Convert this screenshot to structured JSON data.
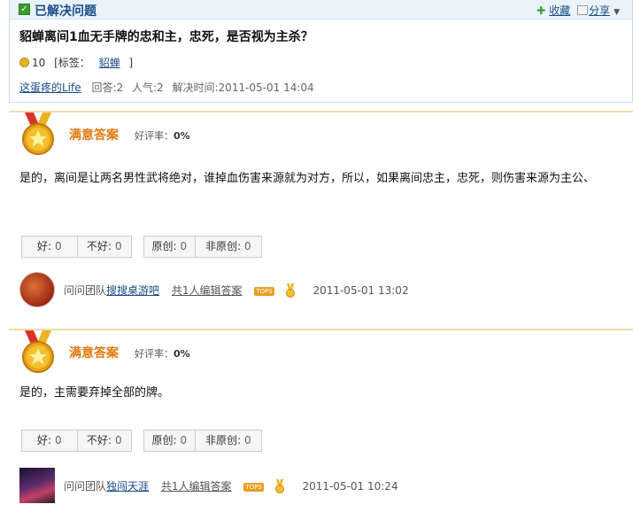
{
  "question": {
    "status_label": "已解决问题",
    "collect_label": "收藏",
    "share_label": "分享",
    "title": "貂蝉离间1血无手牌的忠和主，忠死，是否视为主杀？",
    "reward": "10",
    "tags_prefix": "[标签：",
    "tag": "貂蝉",
    "tags_suffix": "]",
    "asker": "这蛋疼的Life",
    "answers_count": "回答:2",
    "popularity": "人气:2",
    "solved_time": "解决时间:2011-05-01 14:04"
  },
  "answers": [
    {
      "title": "满意答案",
      "rate_label": "好评率：",
      "rate_value": "0%",
      "text": "是的，离间是让两名男性武将绝对，谁掉血伤害来源就为对方，所以，如果离间忠主，忠死，则伤害来源为主公、",
      "good_label": "好:",
      "good_count": "0",
      "bad_label": "不好:",
      "bad_count": "0",
      "orig_label": "原创:",
      "orig_count": "0",
      "nonorig_label": "非原创:",
      "nonorig_count": "0",
      "team_label": "问问团队",
      "user": "搜搜桌游吧",
      "editors": "共1人编辑答案",
      "tops_badge": "TOPS",
      "time": "2011-05-01 13:02"
    },
    {
      "title": "满意答案",
      "rate_label": "好评率：",
      "rate_value": "0%",
      "text": "是的，主需要弃掉全部的牌。",
      "good_label": "好:",
      "good_count": "0",
      "bad_label": "不好:",
      "bad_count": "0",
      "orig_label": "原创:",
      "orig_count": "0",
      "nonorig_label": "非原创:",
      "nonorig_count": "0",
      "team_label": "问问团队",
      "user": "独闯天涯",
      "editors": "共1人编辑答案",
      "tops_badge": "TOPS",
      "time": "2011-05-01 10:24"
    }
  ],
  "colors": {
    "accent": "#1a4d85",
    "orange": "#e07a10",
    "gold": "#e8b420"
  }
}
